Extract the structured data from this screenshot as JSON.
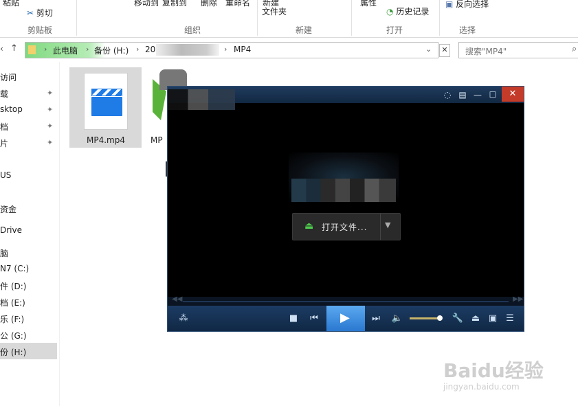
{
  "ribbon": {
    "top_labels": [
      "粘贴",
      "移动到",
      "复制到",
      "删除",
      "重命名",
      "新建",
      "属性"
    ],
    "cut": "剪切",
    "new_folder": "文件夹",
    "history": "历史记录",
    "invert_selection": "反向选择",
    "groups": [
      "剪贴板",
      "组织",
      "新建",
      "打开",
      "选择"
    ]
  },
  "address": {
    "segments": [
      "此电脑",
      "备份 (H:)",
      "20",
      "MP4"
    ],
    "search_placeholder": "搜索\"MP4\""
  },
  "nav": {
    "items": [
      "访问",
      "载",
      "sktop",
      "档",
      "片",
      "US",
      "资金",
      "Drive",
      "脑",
      "N7 (C:)",
      "件 (D:)",
      "档 (E:)",
      "乐 (F:)",
      "公 (G:)",
      "份 (H:)"
    ]
  },
  "files": [
    {
      "name": "MP4.mp4",
      "selected": true
    },
    {
      "name": "MP",
      "selected": false
    }
  ],
  "player": {
    "open_label": "打开文件...",
    "volume_level": 0.9
  },
  "watermark": {
    "brand": "Baidu经验",
    "url": "jingyan.baidu.com"
  },
  "colors": {
    "titlebar": "#1f3b5e",
    "close": "#c43b2a",
    "play": "#3a8ee6",
    "address_green": "#6cd36c"
  }
}
